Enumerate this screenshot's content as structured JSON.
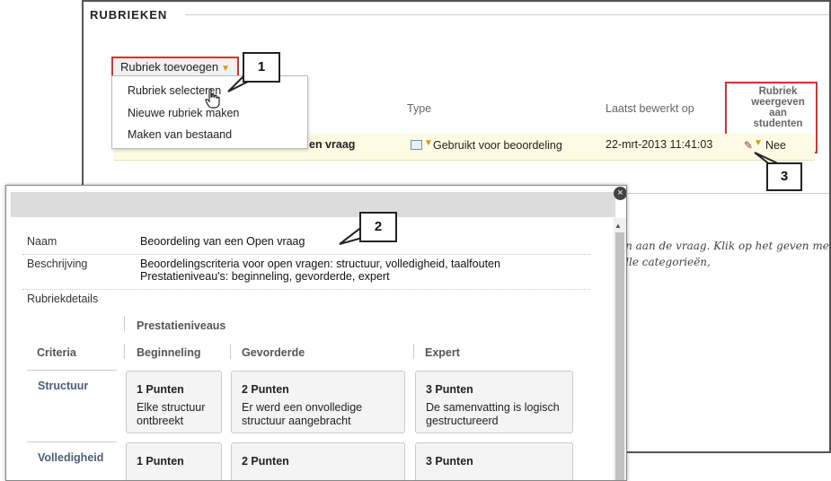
{
  "back": {
    "title": "RUBRIEKEN",
    "add_button": "Rubriek toevoegen",
    "menu": {
      "items": [
        "Rubriek selecteren",
        "Nieuwe rubriek maken",
        "Maken van bestaand"
      ]
    },
    "columns": {
      "type": "Type",
      "date": "Laatst bewerkt op",
      "show": "Rubriek weergeven aan studenten"
    },
    "row": {
      "name": "en vraag",
      "type": "Gebruikt voor beoordeling",
      "date": "22-mrt-2013 11:41:03",
      "show": "Nee"
    },
    "bg_text": "en aan de vraag. Klik op het geven met alle categorieën,"
  },
  "callouts": [
    "1",
    "2",
    "3"
  ],
  "dialog": {
    "close_label": "×",
    "name_label": "Naam",
    "name_value": "Beoordeling van een Open vraag",
    "desc_label": "Beschrijving",
    "desc_line1": "Beoordelingscriteria voor open vragen: structuur, volledigheid, taalfouten",
    "desc_line2": "Prestatieniveau's: beginneling, gevorderde, expert",
    "details_label": "Rubriekdetails",
    "levels_header": "Prestatieniveaus",
    "criteria_header": "Criteria",
    "levels": [
      "Beginneling",
      "Gevorderde",
      "Expert"
    ],
    "criteria": [
      {
        "name": "Structuur",
        "cells": [
          {
            "points": "1 Punten",
            "desc": "Elke structuur ontbreekt"
          },
          {
            "points": "2 Punten",
            "desc": "Er werd een onvolledige structuur aangebracht"
          },
          {
            "points": "3 Punten",
            "desc": "De samenvatting is logisch gestructureerd"
          }
        ]
      },
      {
        "name": "Volledigheid",
        "cells": [
          {
            "points": "1 Punten",
            "desc": ""
          },
          {
            "points": "2 Punten",
            "desc": ""
          },
          {
            "points": "3 Punten",
            "desc": ""
          }
        ]
      }
    ]
  },
  "colors": {
    "highlight": "#d9312c",
    "row_bg": "#fdfbe3",
    "chevron": "#d29a13",
    "criteria_text": "#4a5e78"
  },
  "icons": [
    "chevron-down-icon",
    "hand-cursor-icon",
    "table-icon",
    "pencil-icon",
    "close-icon",
    "scroll-up-icon"
  ]
}
